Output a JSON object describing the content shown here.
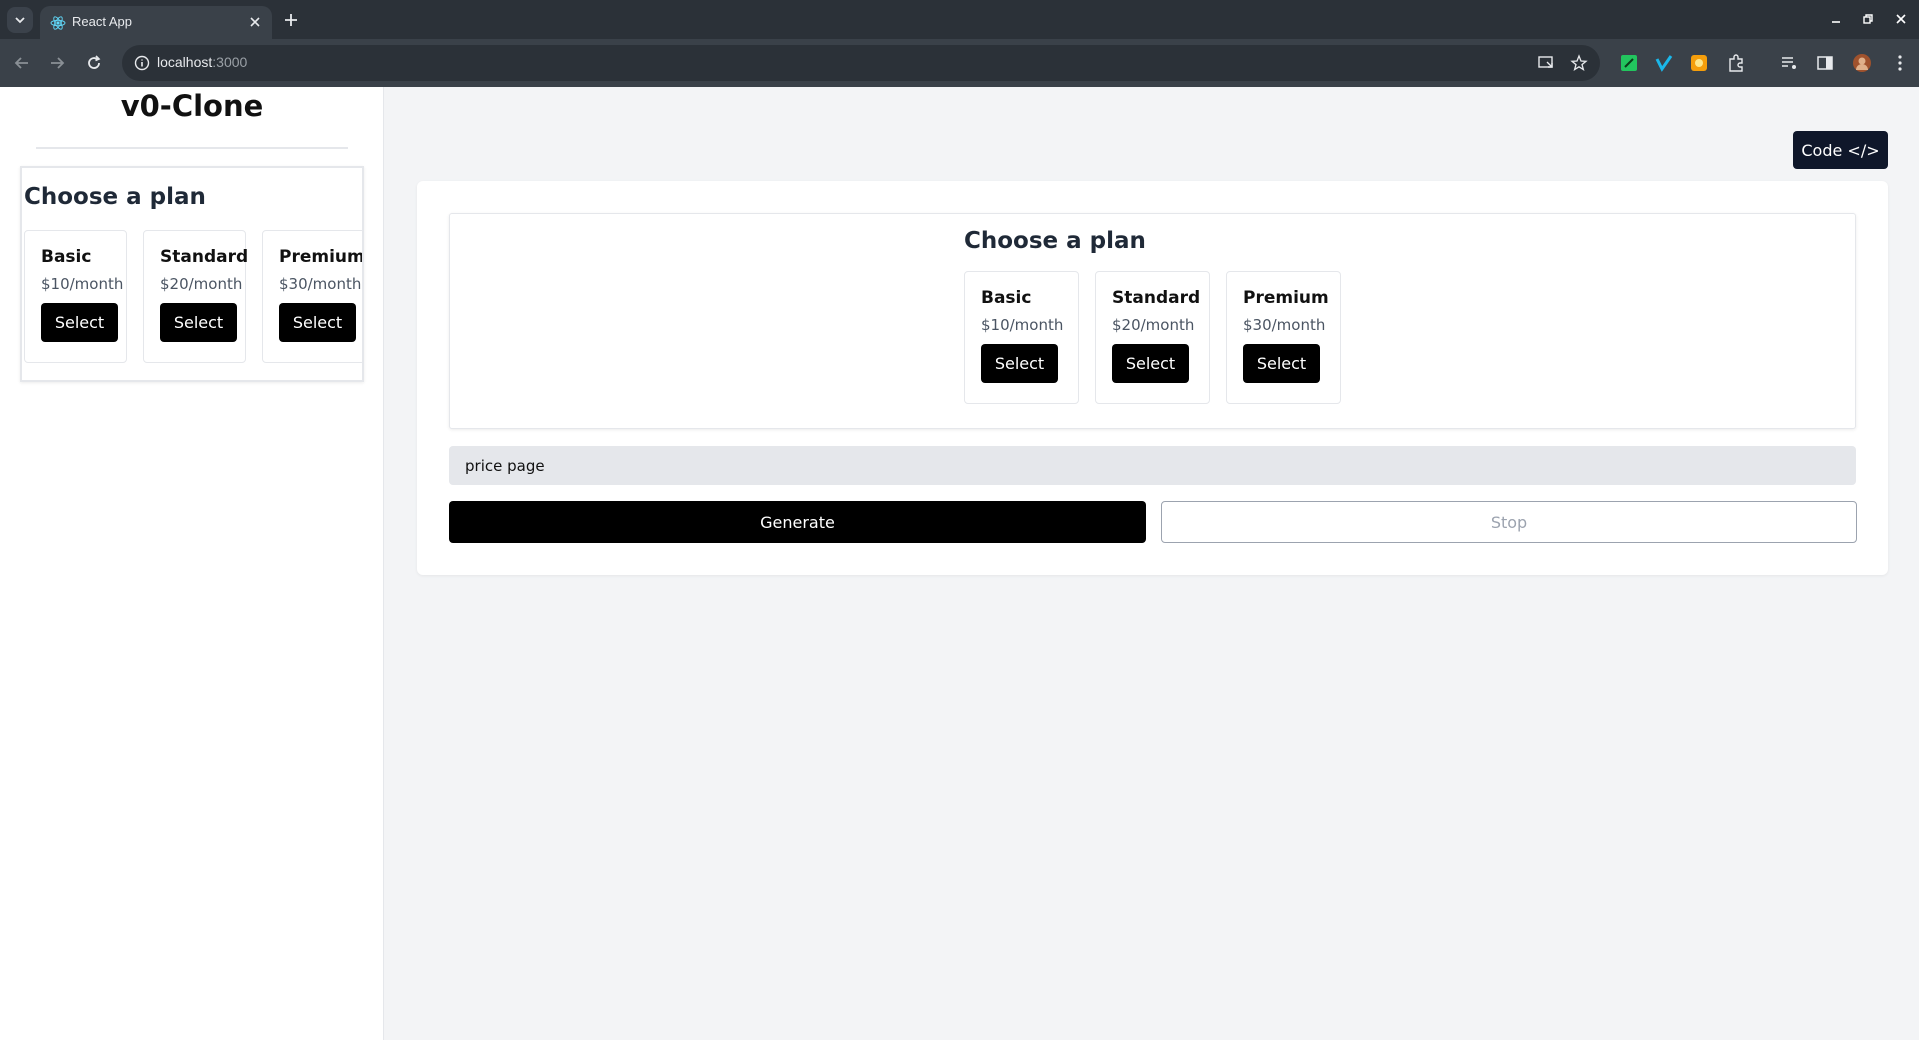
{
  "browser": {
    "tab_title": "React App",
    "url_host": "localhost",
    "url_port": ":3000"
  },
  "sidebar": {
    "app_title": "v0-Clone",
    "preview": {
      "heading": "Choose a plan",
      "plans": [
        {
          "name": "Basic",
          "price": "$10/month",
          "button": "Select"
        },
        {
          "name": "Standard",
          "price": "$20/month",
          "button": "Select"
        },
        {
          "name": "Premium",
          "price": "$30/month",
          "button": "Select"
        }
      ]
    }
  },
  "main": {
    "code_button": "Code </>",
    "preview": {
      "heading": "Choose a plan",
      "plans": [
        {
          "name": "Basic",
          "price": "$10/month",
          "button": "Select"
        },
        {
          "name": "Standard",
          "price": "$20/month",
          "button": "Select"
        },
        {
          "name": "Premium",
          "price": "$30/month",
          "button": "Select"
        }
      ]
    },
    "prompt_value": "price page",
    "generate_label": "Generate",
    "stop_label": "Stop"
  },
  "colors": {
    "primary_button": "#000000",
    "code_button": "#0f172a",
    "page_background": "#f3f4f6",
    "input_background": "#e5e7eb"
  },
  "icons": [
    "tab-search-icon",
    "react-logo-icon",
    "close-icon",
    "plus-icon",
    "minimize-icon",
    "restore-icon",
    "back-icon",
    "forward-icon",
    "reload-icon",
    "info-icon",
    "install-app-icon",
    "star-icon",
    "extension-icon",
    "media-icon",
    "side-panel-icon",
    "profile-avatar",
    "more-icon"
  ]
}
